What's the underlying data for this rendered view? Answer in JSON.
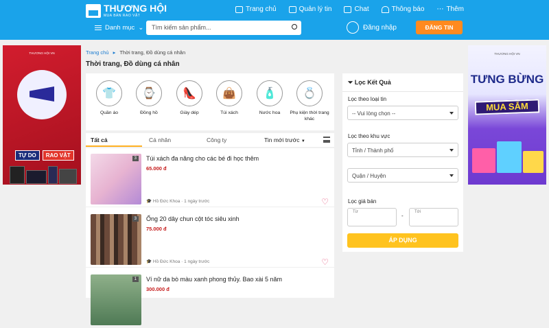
{
  "brand": {
    "name": "THƯƠNG HỘI",
    "tagline": "MUA BÁN RAO VẶT"
  },
  "nav": {
    "home": "Trang chủ",
    "manage": "Quản lý tin",
    "chat": "Chat",
    "notify": "Thông báo",
    "more": "Thêm"
  },
  "header": {
    "category": "Danh mục",
    "search_placeholder": "Tìm kiếm sản phẩm...",
    "login": "Đăng nhập",
    "post": "ĐĂNG TIN"
  },
  "left_banner": {
    "brand": "THƯƠNG HỘI VN",
    "tag1": "TỰ DO",
    "tag2": "RAO VẶT"
  },
  "right_banner": {
    "brand": "THƯƠNG HỘI VN",
    "line1": "TƯNG BỪNG",
    "line2": "MUA SẮM"
  },
  "breadcrumb": {
    "home": "Trang chủ",
    "sep": "▸",
    "current": "Thời trang, Đồ dùng cá nhân"
  },
  "page_title": "Thời trang, Đồ dùng cá nhân",
  "categories": [
    {
      "label": "Quần áo",
      "icon": "shirt-icon"
    },
    {
      "label": "Đồng hồ",
      "icon": "watch-icon"
    },
    {
      "label": "Giày dép",
      "icon": "heel-icon"
    },
    {
      "label": "Túi xách",
      "icon": "bag-icon"
    },
    {
      "label": "Nước hoa",
      "icon": "perfume-icon"
    },
    {
      "label": "Phụ kiện thời trang khác",
      "icon": "ring-icon"
    }
  ],
  "tabs": {
    "all": "Tất cả",
    "personal": "Cá nhân",
    "company": "Công ty",
    "sort": "Tin mới trước"
  },
  "listings": [
    {
      "title": "Túi xách đa năng cho các bé đi học thêm",
      "price": "65.000 đ",
      "seller": "Hồ Đức Khoa",
      "time": "1 ngày trước",
      "images": "3"
    },
    {
      "title": "Ống 20 dây chun cột tóc siêu xinh",
      "price": "75.000 đ",
      "seller": "Hồ Đức Khoa",
      "time": "1 ngày trước",
      "images": "3"
    },
    {
      "title": "Ví nữ da bò màu xanh phong thủy. Bao xài 5 năm",
      "price": "300.000 đ",
      "seller": "",
      "time": "",
      "images": "1"
    }
  ],
  "filter": {
    "title": "Lọc Kết Quả",
    "type_label": "Lọc theo loại tin",
    "type_value": "-- Vui lòng chọn --",
    "area_label": "Lọc theo khu vực",
    "province": "Tỉnh / Thành phố",
    "district": "Quận / Huyện",
    "price_label": "Lọc giá bán",
    "from": "Từ",
    "to": "Tới",
    "dash": "-",
    "apply": "ÁP DỤNG"
  }
}
